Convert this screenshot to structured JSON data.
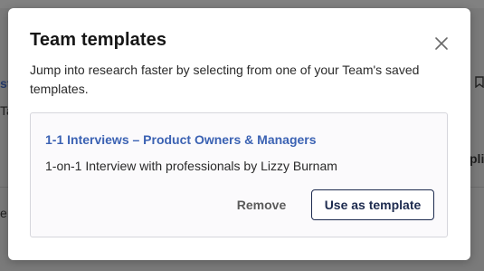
{
  "background": {
    "fragments": [
      "st",
      "Ta",
      "pli",
      "e"
    ]
  },
  "modal": {
    "title": "Team templates",
    "description": "Jump into research faster by selecting from one of your Team's saved templates.",
    "close_icon": "close-icon",
    "template": {
      "name": "1-1 Interviews – Product Owners & Managers",
      "description": "1-on-1 Interview with professionals by Lizzy Burnam",
      "remove_label": "Remove",
      "use_label": "Use as template"
    }
  },
  "colors": {
    "link": "#3b62b3",
    "primary_border": "#1d2b4f",
    "overlay": "#7b7b7b"
  }
}
